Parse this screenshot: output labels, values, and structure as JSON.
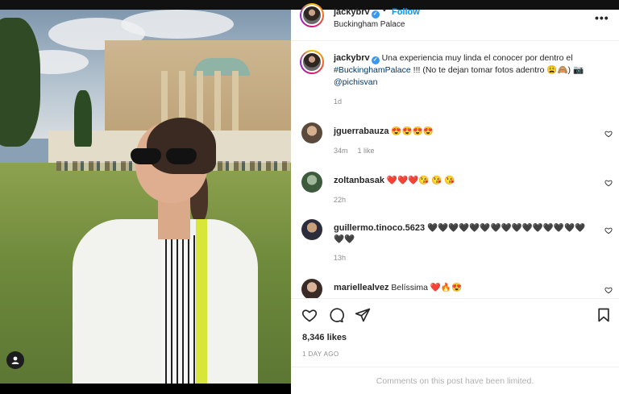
{
  "post": {
    "username": "jackybrv",
    "follow_label": "Follow",
    "separator": "•",
    "location": "Buckingham Palace",
    "more_label": "•••"
  },
  "caption": {
    "username": "jackybrv",
    "text_before": "Una experiencia muy linda el conocer por dentro el",
    "hashtag": "#BuckinghamPalace",
    "text_after": "!!! (No te dejan tomar fotos adentro 😩🙈)",
    "camera": "📷",
    "mention": "@pichisvan",
    "time": "1d"
  },
  "comments": [
    {
      "username": "jguerrabauza",
      "emojis": "😍😍😍😍",
      "time": "34m",
      "likes": "1 like"
    },
    {
      "username": "zoltanbasak",
      "emojis": "❤️❤️❤️😘 😘 😘",
      "time": "22h",
      "likes": ""
    },
    {
      "username": "guillermo.tinoco.5623",
      "emojis": "🖤🖤🖤🖤🖤🖤🖤🖤🖤🖤🖤🖤🖤🖤🖤🖤🖤",
      "time": "13h",
      "likes": ""
    },
    {
      "username": "mariellealvez",
      "emojis": "Belíssima ❤️🔥😍",
      "time": "",
      "likes": ""
    }
  ],
  "footer": {
    "likes": "8,346 likes",
    "posted": "1 DAY AGO",
    "limited_notice": "Comments on this post have been limited."
  },
  "icons": {
    "like": "heart-icon",
    "comment": "comment-icon",
    "share": "paper-plane-icon",
    "save": "bookmark-icon",
    "tagged": "person-tag-icon"
  },
  "colors": {
    "link": "#0095f6",
    "verified": "#3897f0",
    "muted": "#8e8e8e"
  }
}
